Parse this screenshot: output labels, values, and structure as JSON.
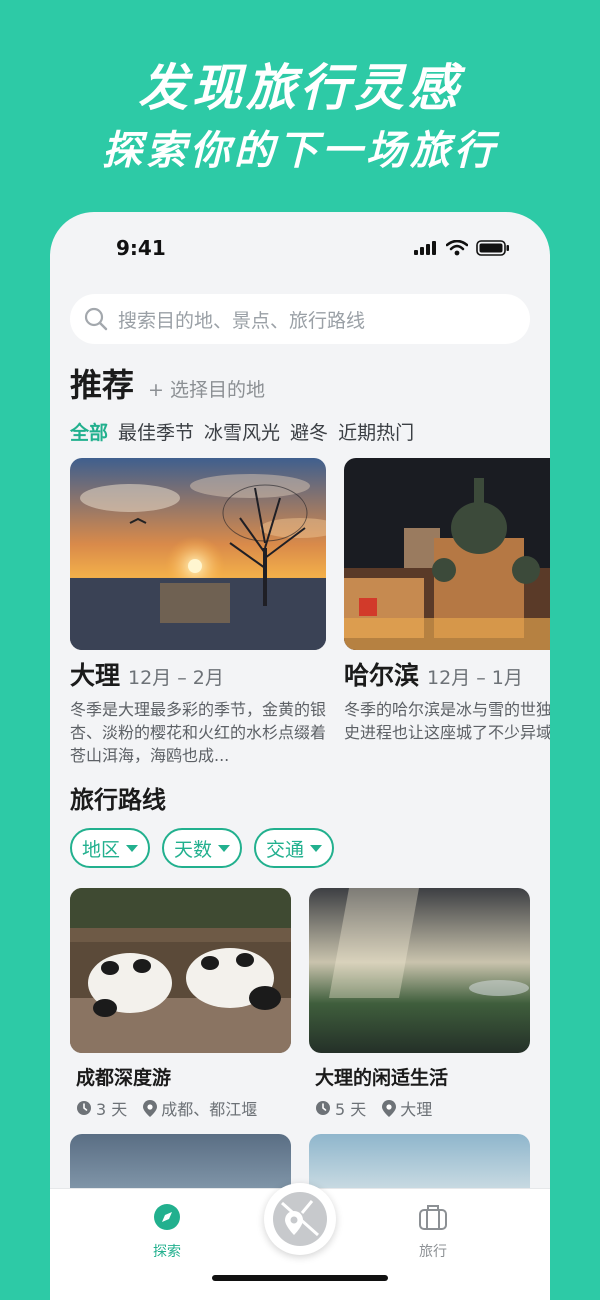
{
  "promo": {
    "headline": "发现旅行灵感",
    "subheadline": "探索你的下一场旅行"
  },
  "status_bar": {
    "time": "9:41"
  },
  "search": {
    "placeholder": "搜索目的地、景点、旅行路线"
  },
  "recommend": {
    "title": "推荐",
    "pick_destination": "+ 选择目的地",
    "tabs": [
      {
        "label": "全部",
        "active": true
      },
      {
        "label": "最佳季节",
        "active": false
      },
      {
        "label": "冰雪风光",
        "active": false
      },
      {
        "label": "避冬",
        "active": false
      },
      {
        "label": "近期热门",
        "active": false
      }
    ],
    "cards": [
      {
        "name": "大理",
        "dates": "12月 – 2月",
        "description": "冬季是大理最多彩的季节，金黄的银杏、淡粉的樱花和火红的水杉点缀着苍山洱海，海鸥也成..."
      },
      {
        "name": "哈尔滨",
        "dates": "12月 – 1月",
        "description": "冬季的哈尔滨是冰与雪的世独特的历史进程也让这座城了不少异域风情。"
      }
    ]
  },
  "routes": {
    "title": "旅行路线",
    "filters": [
      {
        "label": "地区"
      },
      {
        "label": "天数"
      },
      {
        "label": "交通"
      }
    ],
    "cards": [
      {
        "name": "成都深度游",
        "days": "3 天",
        "places": "成都、都江堰"
      },
      {
        "name": "大理的闲适生活",
        "days": "5 天",
        "places": "大理"
      }
    ]
  },
  "tabbar": {
    "explore": "探索",
    "trip": "旅行"
  },
  "colors": {
    "brand": "#2dcaa6",
    "accent": "#22b08e",
    "page_bg": "#f3f4f6"
  }
}
